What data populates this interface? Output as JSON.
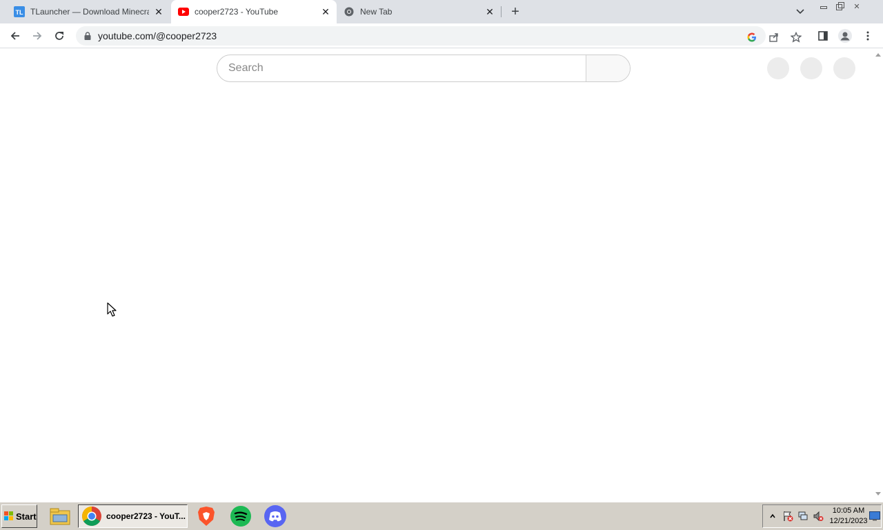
{
  "browser": {
    "tabs": [
      {
        "title": "TLauncher — Download Minecraft L",
        "favicon": "tlauncher-icon",
        "active": false
      },
      {
        "title": "cooper2723 - YouTube",
        "favicon": "youtube-icon",
        "active": true
      },
      {
        "title": "New Tab",
        "favicon": "chrome-icon",
        "active": false
      }
    ],
    "tab_favicon_text": "TL",
    "url": "youtube.com/@cooper2723"
  },
  "page": {
    "search_placeholder": "Search"
  },
  "taskbar": {
    "start_label": "Start",
    "active_window_label": "cooper2723 - YouT...",
    "apps": [
      "file-explorer-icon",
      "chrome-icon",
      "brave-icon",
      "spotify-icon",
      "discord-icon"
    ],
    "clock_time": "10:05 AM",
    "clock_date": "12/21/2023"
  },
  "colors": {
    "tabstrip_bg": "#dee1e6",
    "youtube_red": "#ff0000",
    "taskbar_bg": "#d4d0c8",
    "spotify_green": "#1db954",
    "discord_blurple": "#5865f2",
    "brave_orange": "#fb542b"
  }
}
